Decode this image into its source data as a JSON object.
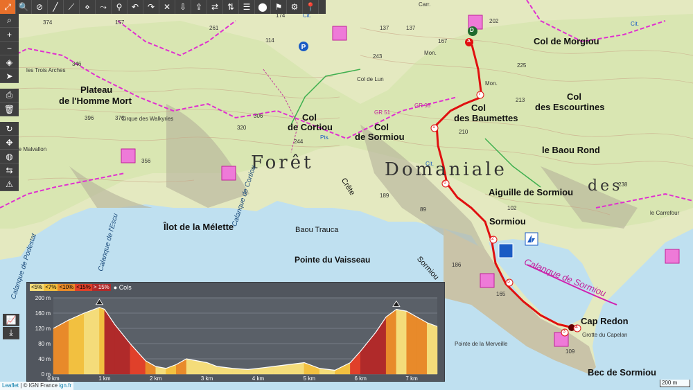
{
  "toolbar": {
    "icons": [
      "fullscreen-icon",
      "search-icon",
      "eye-slash-icon",
      "draw-line-icon",
      "draw-multiline-icon",
      "nodes-icon",
      "route-icon",
      "bike-icon",
      "undo-icon",
      "redo-icon",
      "hide-icon",
      "export-icon",
      "swap-icon",
      "sort-icon",
      "list-icon",
      "marker-icon",
      "settings-icon"
    ]
  },
  "sidebar": {
    "icons": [
      "search-icon",
      "zoom-in-icon",
      "zoom-out-icon",
      "layers-icon",
      "send-icon",
      "print-icon",
      "trash-icon",
      "refresh-icon",
      "measure-icon",
      "globe-icon",
      "share-icon",
      "warning-icon",
      "chart-icon",
      "download-icon"
    ]
  },
  "map": {
    "labels": {
      "plateau": "Plateau",
      "homme_mort": "de l'Homme Mort",
      "trois_arches": "les Trois Arches",
      "cirque": "Cirque des Walkyries",
      "malvallon": "Tête de Malvallon",
      "col_cortiou_1": "Col",
      "col_cortiou_2": "de Cortiou",
      "col_sormiou_1": "Col",
      "col_sormiou_2": "de Sormiou",
      "col_lun": "Col de Lun",
      "col_baumettes_1": "Col",
      "col_baumettes_2": "des Baumettes",
      "col_morgiou": "Col de Morgiou",
      "col_escourtines_1": "Col",
      "col_escourtines_2": "des Escourtines",
      "baou_rond": "le Baou Rond",
      "aiguille": "Aiguille de Sormiou",
      "sormiou": "Sormiou",
      "foret": "Forêt",
      "domaniale": "Domaniale",
      "des": "des",
      "ilot": "Îlot de la Mélette",
      "baou_trauca": "Baou Trauca",
      "pointe_vaisseau": "Pointe du Vaisseau",
      "calanque_cortiou": "Calanque de Cortiou",
      "calanque_escu": "Calanque de l'Escu",
      "calanque_podestat": "Calanque de Podestat",
      "calanque_sormiou": "Calanque de Sormiou",
      "cap_redon": "Cap Redon",
      "grotte": "Grotte du Capelan",
      "pointe_merveille": "Pointe de la Merveille",
      "bec_sormiou": "Bec de Sormiou",
      "carrefour": "le Carrefour",
      "crete": "Crête",
      "crete_sormiou": "Sormiou",
      "mon1": "Mon.",
      "mon2": "Mon.",
      "carr": "Carr.",
      "gr": "GR 51",
      "gr98": "GR 98",
      "cit1": "Cit.",
      "cit2": "Cit.",
      "cit3": "Cit.",
      "pts": "Pts."
    },
    "elevations": [
      "374",
      "346",
      "396",
      "376",
      "261",
      "114",
      "167",
      "202",
      "225",
      "213",
      "243",
      "320",
      "306",
      "244",
      "210",
      "238",
      "102",
      "186",
      "165",
      "109",
      "356",
      "189",
      "89",
      "157",
      "174",
      "137",
      "137"
    ],
    "markers": {
      "start": "D",
      "arrival": "A",
      "waypoints": [
        "1",
        "2",
        "3",
        "4",
        "5",
        "6",
        "7"
      ]
    }
  },
  "profile": {
    "legend": [
      "<5%",
      "<7%",
      "<10%",
      "<15%",
      "> 15%"
    ],
    "legend_colors": [
      "#f4dc7a",
      "#f2c040",
      "#e88a2a",
      "#e0402a",
      "#b02a2a"
    ],
    "cols_label": "Cols",
    "chart_data": {
      "type": "area",
      "xlabel": "",
      "ylabel": "",
      "x_unit": "km",
      "y_unit": "m",
      "ylim": [
        0,
        200
      ],
      "xlim": [
        0,
        7.5
      ],
      "y_ticks": [
        "0 m",
        "40 m",
        "80 m",
        "120 m",
        "160 m",
        "200 m"
      ],
      "x_ticks": [
        "0 km",
        "1 km",
        "2 km",
        "3 km",
        "4 km",
        "5 km",
        "6 km",
        "7 km"
      ],
      "x": [
        0,
        0.3,
        0.6,
        0.9,
        1.0,
        1.2,
        1.5,
        1.8,
        2.0,
        2.2,
        2.4,
        2.6,
        2.8,
        3.0,
        3.2,
        3.5,
        3.8,
        4.0,
        4.3,
        4.6,
        4.9,
        5.2,
        5.5,
        5.8,
        6.0,
        6.3,
        6.5,
        6.7,
        6.9,
        7.1,
        7.3,
        7.5
      ],
      "y": [
        120,
        142,
        160,
        175,
        170,
        130,
        80,
        35,
        20,
        15,
        25,
        40,
        35,
        30,
        20,
        15,
        12,
        15,
        20,
        25,
        30,
        15,
        10,
        30,
        60,
        110,
        150,
        170,
        165,
        150,
        135,
        125
      ],
      "cols_markers_km": [
        0.9,
        6.7
      ]
    }
  },
  "attribution": {
    "leaflet": "Leaflet",
    "rest": " | © IGN France ",
    "ign": "ign.fr"
  },
  "scale": "200 m"
}
